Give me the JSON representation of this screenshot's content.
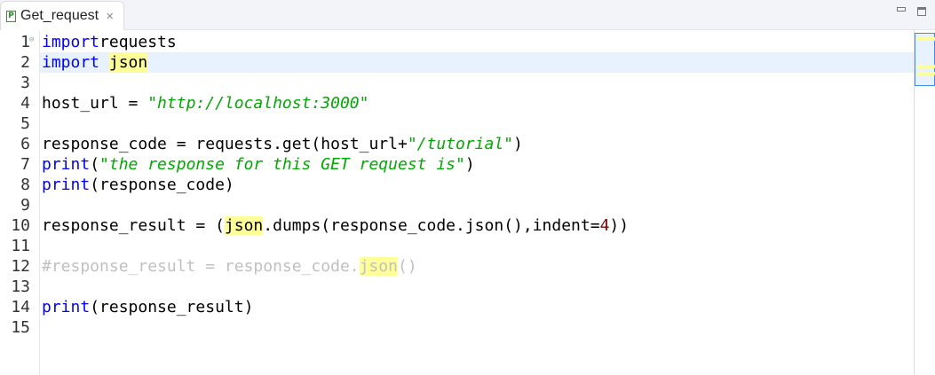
{
  "tab": {
    "title": "Get_request",
    "file_icon": "python-file-icon",
    "close_icon": "close-icon"
  },
  "window_controls": [
    "minimize",
    "maximize"
  ],
  "editor": {
    "current_line": 2,
    "lines": [
      {
        "n": "1",
        "fold": true,
        "tokens": [
          [
            "kw",
            "import"
          ],
          [
            "",
            "requests"
          ]
        ]
      },
      {
        "n": "2",
        "tokens": [
          [
            "kw",
            "import"
          ],
          [
            "",
            " "
          ],
          [
            "hl",
            "json"
          ]
        ]
      },
      {
        "n": "3",
        "tokens": []
      },
      {
        "n": "4",
        "tokens": [
          [
            "",
            "host_url = "
          ],
          [
            "str",
            "\"http://localhost:3000\""
          ]
        ]
      },
      {
        "n": "5",
        "tokens": []
      },
      {
        "n": "6",
        "tokens": [
          [
            "",
            "response_code = requests.get(host_url+"
          ],
          [
            "str",
            "\"/tutorial\""
          ],
          [
            "",
            ")"
          ]
        ]
      },
      {
        "n": "7",
        "tokens": [
          [
            "kw",
            "print"
          ],
          [
            "",
            "("
          ],
          [
            "str",
            "\"the response for this GET request is\""
          ],
          [
            "",
            ")"
          ]
        ]
      },
      {
        "n": "8",
        "tokens": [
          [
            "kw",
            "print"
          ],
          [
            "",
            "(response_code)"
          ]
        ]
      },
      {
        "n": "9",
        "tokens": []
      },
      {
        "n": "10",
        "tokens": [
          [
            "",
            "response_result = ("
          ],
          [
            "hl",
            "json"
          ],
          [
            "",
            ".dumps(response_code.json(),indent="
          ],
          [
            "num",
            "4"
          ],
          [
            "",
            "))"
          ]
        ]
      },
      {
        "n": "11",
        "tokens": []
      },
      {
        "n": "12",
        "tokens": [
          [
            "com",
            "#response_result = response_code."
          ],
          [
            "com hl",
            "json"
          ],
          [
            "com",
            "()"
          ]
        ]
      },
      {
        "n": "13",
        "tokens": []
      },
      {
        "n": "14",
        "tokens": [
          [
            "kw",
            "print"
          ],
          [
            "",
            "(response_result)"
          ]
        ]
      },
      {
        "n": "15",
        "tokens": []
      }
    ]
  }
}
